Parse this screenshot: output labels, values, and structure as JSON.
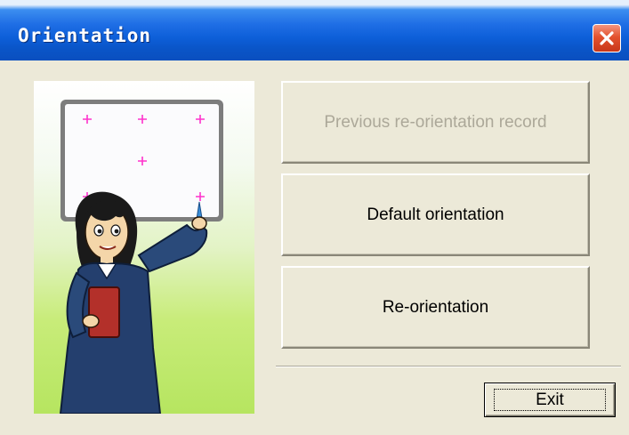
{
  "window": {
    "title": "Orientation"
  },
  "buttons": {
    "previous_record": "Previous re-orientation record",
    "previous_record_enabled": false,
    "default_orientation": "Default orientation",
    "re_orientation": "Re-orientation",
    "exit": "Exit"
  },
  "icons": {
    "close": "close-icon",
    "illustration": "teacher-at-whiteboard-illustration"
  },
  "colors": {
    "title_bar": "#0a5fd8",
    "close_button": "#e3522e",
    "target_markers": "#ff33cc",
    "disabled_text": "#aca899"
  }
}
